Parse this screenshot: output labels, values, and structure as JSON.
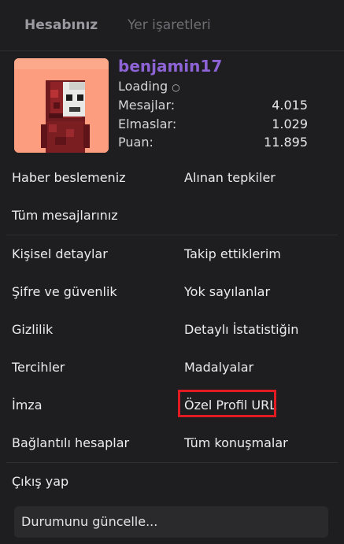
{
  "tabs": {
    "account": "Hesabınız",
    "bookmarks": "Yer işaretleri"
  },
  "profile": {
    "username": "benjamin17",
    "username_color": "#8d63d6",
    "loading": "Loading",
    "loading_icon": "spinner-icon",
    "stats": [
      {
        "label": "Mesajlar:",
        "value": "4.015"
      },
      {
        "label": "Elmaslar:",
        "value": "1.029"
      },
      {
        "label": "Puan:",
        "value": "11.895"
      }
    ]
  },
  "menu": {
    "news_feed": "Haber beslemeniz",
    "reactions_received": "Alınan tepkiler",
    "all_posts": "Tüm mesajlarınız",
    "personal_details": "Kişisel detaylar",
    "following": "Takip ettiklerim",
    "password_security": "Şifre ve güvenlik",
    "ignored": "Yok sayılanlar",
    "privacy": "Gizlilik",
    "detailed_stats": "Detaylı İstatistiğin",
    "preferences": "Tercihler",
    "medals": "Madalyalar",
    "signature": "İmza",
    "custom_profile_url": "Özel Profil URL",
    "connected_accounts": "Bağlantılı hesaplar",
    "all_conversations": "Tüm konuşmalar",
    "logout": "Çıkış yap"
  },
  "status": {
    "placeholder": "Durumunu güncelle..."
  },
  "colors": {
    "highlight": "#e21b22",
    "background": "#1e1e20"
  }
}
